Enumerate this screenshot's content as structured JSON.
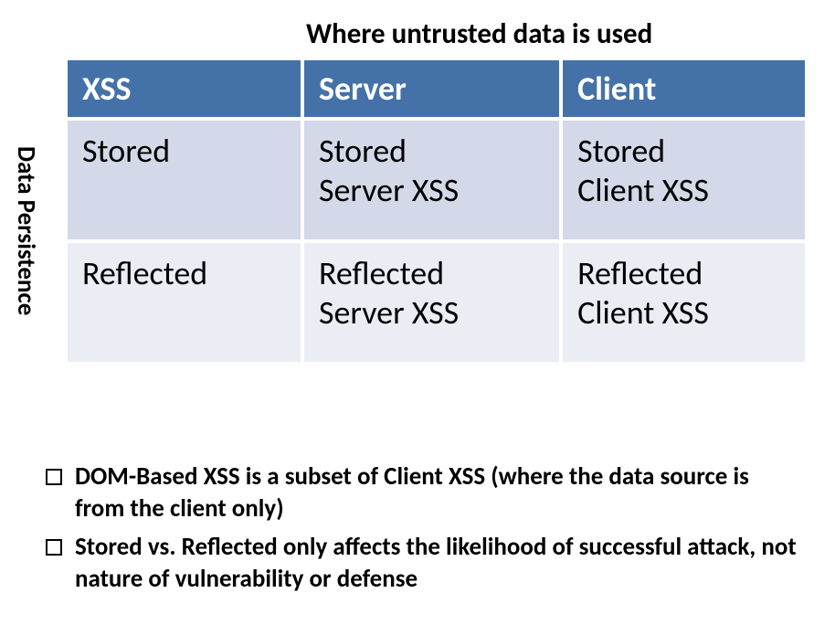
{
  "header_top": "Where untrusted data is used",
  "side_label": "Data Persistence",
  "table": {
    "headers": {
      "col0": "XSS",
      "col1": "Server",
      "col2": "Client"
    },
    "row_stored": {
      "label": "Stored",
      "server_line1": "Stored",
      "server_line2": "Server XSS",
      "client_line1": "Stored",
      "client_line2": "Client XSS"
    },
    "row_reflected": {
      "label": "Reflected",
      "server_line1": "Reflected",
      "server_line2": "Server XSS",
      "client_line1": "Reflected",
      "client_line2": "Client XSS"
    }
  },
  "bullets": {
    "item0": "DOM-Based XSS is a subset of Client XSS (where the data source is from the client only)",
    "item1": "Stored vs. Reflected only affects the likelihood of successful attack, not nature of vulnerability or defense"
  },
  "chart_data": {
    "type": "table",
    "title_top": "Where untrusted data is used",
    "title_left": "Data Persistence",
    "columns": [
      "XSS",
      "Server",
      "Client"
    ],
    "rows": [
      {
        "label": "Stored",
        "Server": "Stored Server XSS",
        "Client": "Stored Client XSS"
      },
      {
        "label": "Reflected",
        "Server": "Reflected Server XSS",
        "Client": "Reflected Client XSS"
      }
    ]
  }
}
